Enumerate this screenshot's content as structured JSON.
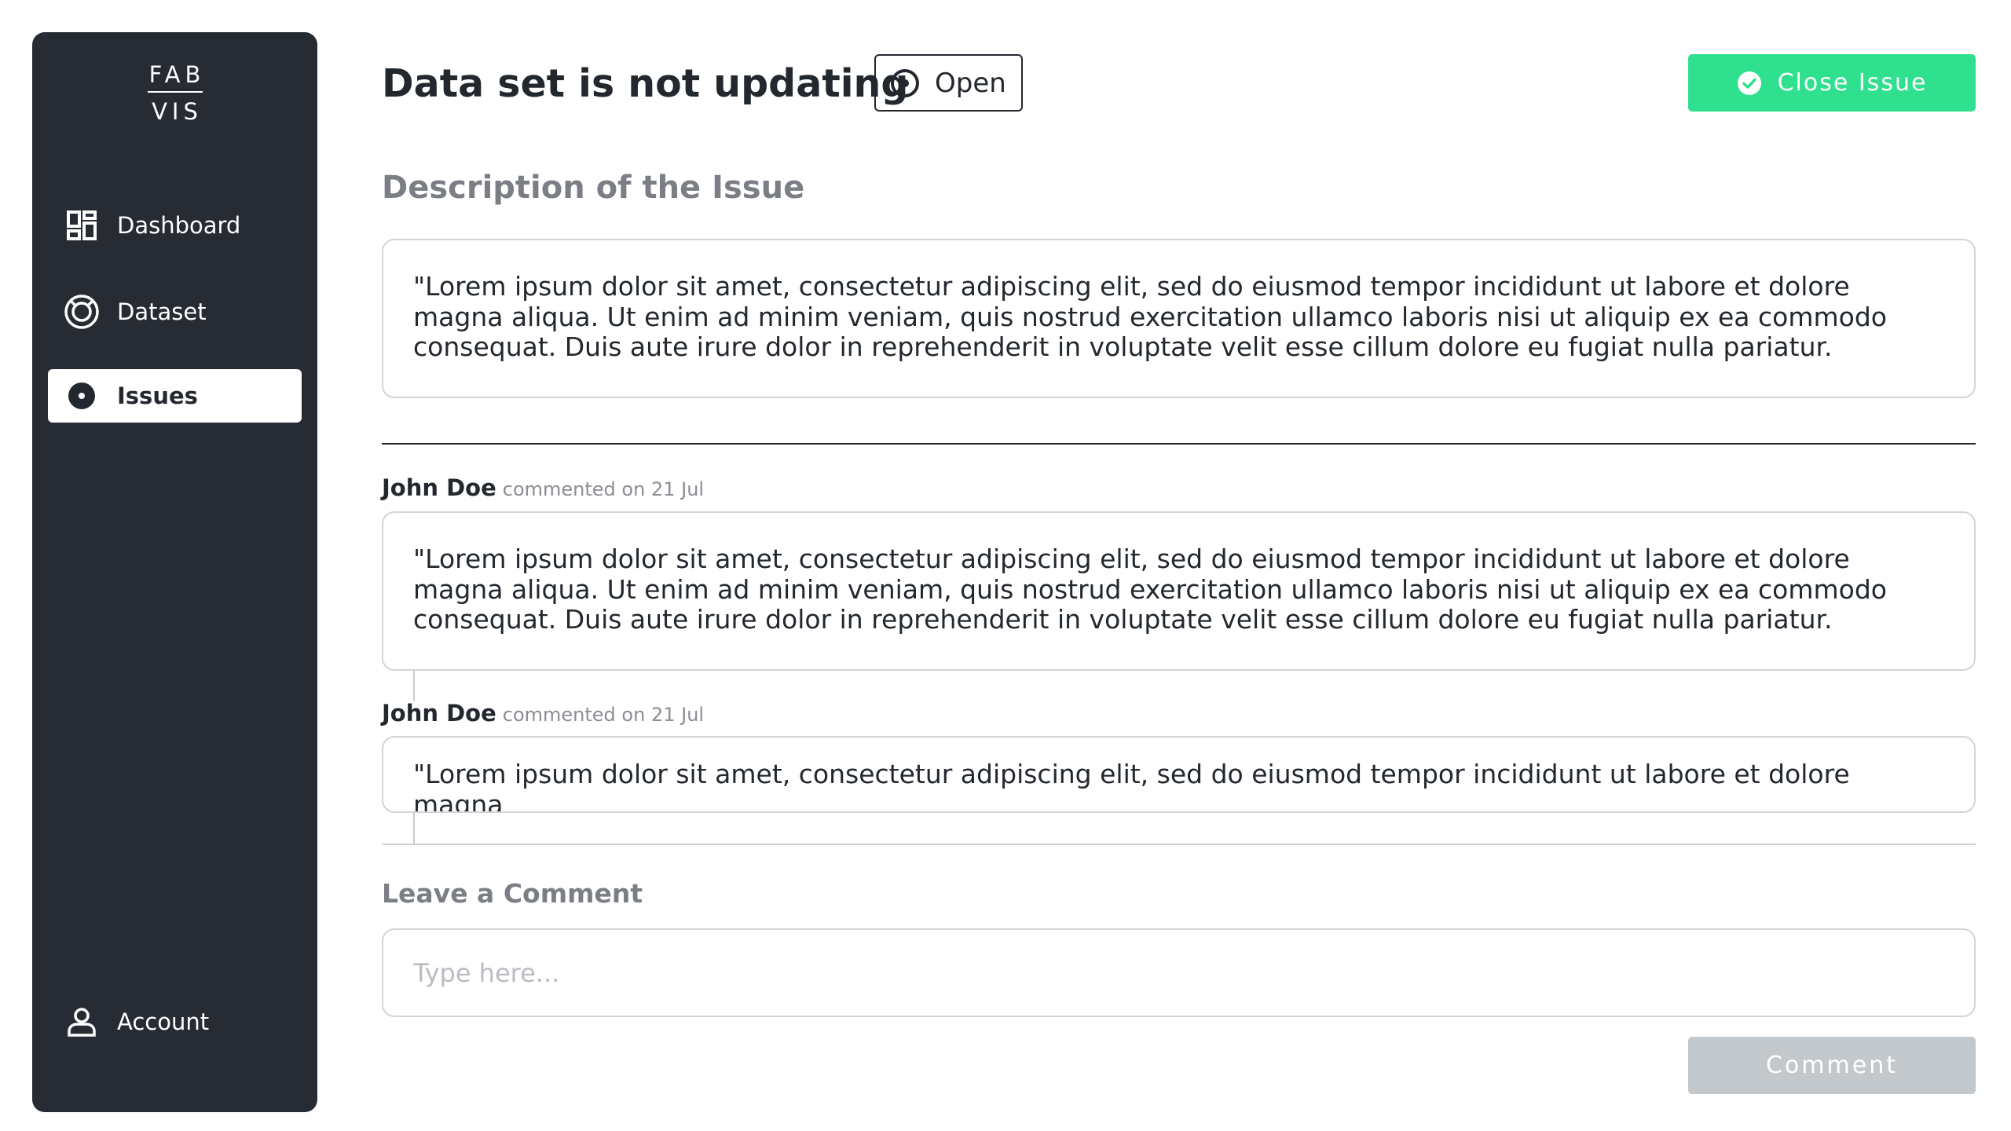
{
  "sidebar": {
    "logo_top": "FAB",
    "logo_bottom": "VIS",
    "items": [
      {
        "label": "Dashboard",
        "icon": "dashboard-icon"
      },
      {
        "label": "Dataset",
        "icon": "dataset-icon"
      },
      {
        "label": "Issues",
        "icon": "issue-dot-icon",
        "active": true
      }
    ],
    "account_label": "Account"
  },
  "issue": {
    "title": "Data set is not updating",
    "status": "Open",
    "close_label": "Close Issue",
    "description_label": "Description of the Issue",
    "description": "\"Lorem ipsum dolor sit amet, consectetur adipiscing elit, sed do eiusmod tempor incididunt ut labore et dolore magna aliqua. Ut enim ad minim veniam, quis nostrud exercitation ullamco laboris nisi ut aliquip ex ea commodo consequat. Duis aute irure dolor in reprehenderit in voluptate velit esse cillum dolore eu fugiat nulla pariatur."
  },
  "comments": [
    {
      "author": "John Doe",
      "meta": "commented on 21 Jul",
      "text": "\"Lorem ipsum dolor sit amet, consectetur adipiscing elit, sed do eiusmod tempor incididunt ut labore et dolore magna aliqua. Ut enim ad minim veniam, quis nostrud exercitation ullamco laboris nisi ut aliquip ex ea commodo consequat. Duis aute irure dolor in reprehenderit in voluptate velit esse cillum dolore eu fugiat nulla pariatur."
    },
    {
      "author": "John Doe",
      "meta": "commented on 21 Jul",
      "text": "\"Lorem ipsum dolor sit amet, consectetur adipiscing elit, sed do eiusmod tempor incididunt ut labore et dolore magna"
    }
  ],
  "new_comment": {
    "heading": "Leave a Comment",
    "placeholder": "Type here...",
    "value": "",
    "submit_label": "Comment"
  },
  "colors": {
    "sidebar_bg": "#272b33",
    "accent_green": "#2fe08e",
    "disabled_button": "#c3c8cc",
    "text_dark": "#23282f",
    "text_muted": "#7b7f85",
    "border": "#d2d4d7"
  }
}
